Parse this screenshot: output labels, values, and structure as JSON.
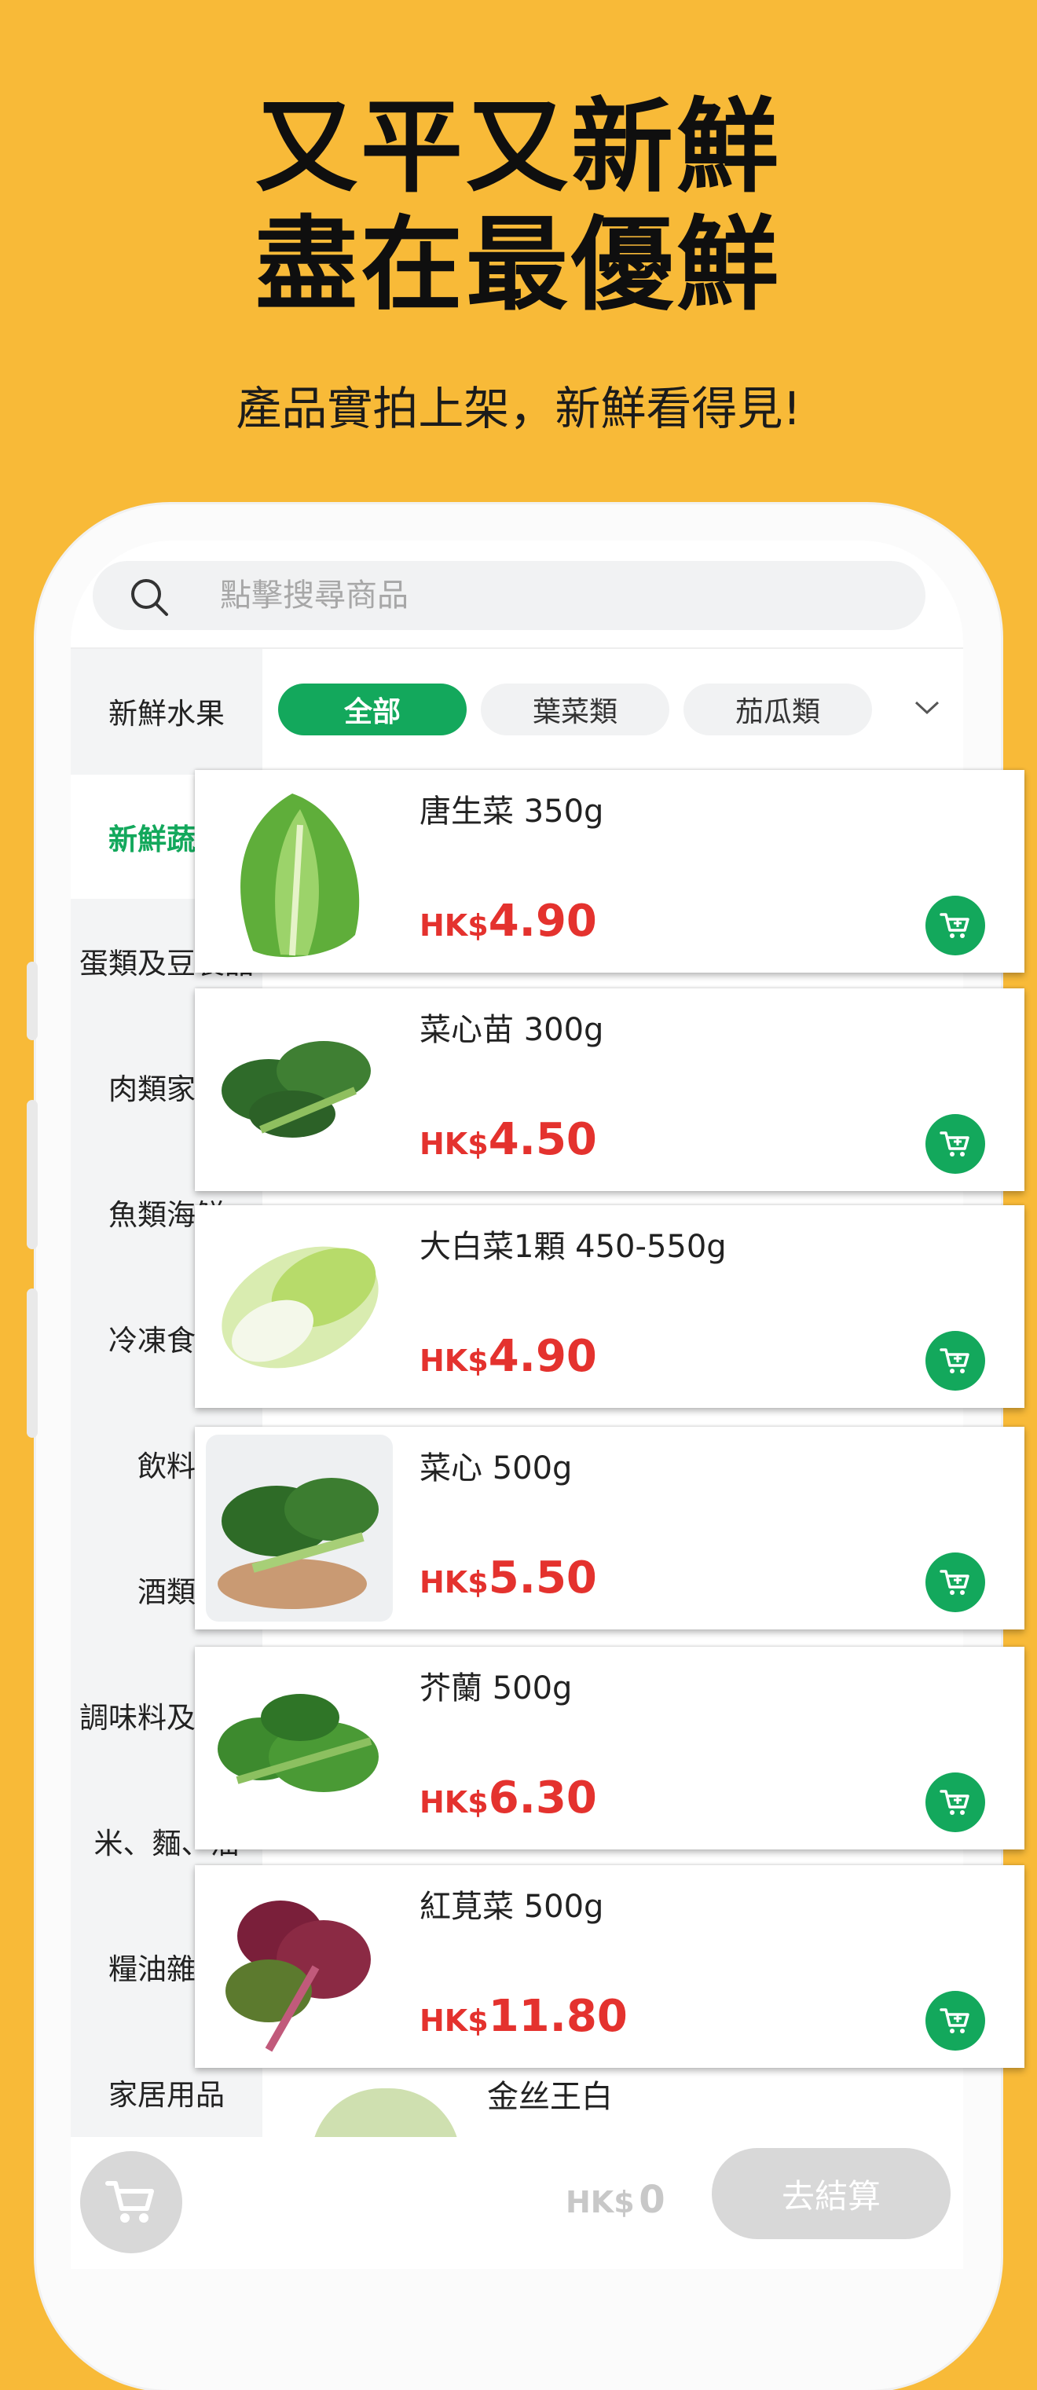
{
  "hero": {
    "headline_line1": "又平又新鮮",
    "headline_line2": "盡在最優鮮",
    "subtitle": "產品實拍上架，新鮮看得見!"
  },
  "search": {
    "placeholder": "點擊搜尋商品",
    "icon": "search-icon"
  },
  "sidebar": {
    "items": [
      {
        "label": "新鮮水果",
        "active": false
      },
      {
        "label": "新鮮蔬菜",
        "active": true
      },
      {
        "label": "蛋類及豆製品",
        "active": false
      },
      {
        "label": "肉類家禽",
        "active": false
      },
      {
        "label": "魚類海鮮",
        "active": false
      },
      {
        "label": "冷凍食品",
        "active": false
      },
      {
        "label": "飲料",
        "active": false
      },
      {
        "label": "酒類",
        "active": false
      },
      {
        "label": "調味料及醬料",
        "active": false
      },
      {
        "label": "米、麵、油",
        "active": false
      },
      {
        "label": "糧油雜貨",
        "active": false
      },
      {
        "label": "家居用品",
        "active": false
      }
    ]
  },
  "filters": {
    "chips": [
      {
        "label": "全部",
        "active": true
      },
      {
        "label": "葉菜類",
        "active": false
      },
      {
        "label": "茄瓜類",
        "active": false
      }
    ],
    "more_icon": "chevron-down-icon"
  },
  "products": [
    {
      "name": "唐生菜 350g",
      "currency": "HK$",
      "price": "4.90",
      "image": "romaine-lettuce"
    },
    {
      "name": "菜心苗 300g",
      "currency": "HK$",
      "price": "4.50",
      "image": "choy-sum-seedling"
    },
    {
      "name": "大白菜1顆 450-550g",
      "currency": "HK$",
      "price": "4.90",
      "image": "napa-cabbage"
    },
    {
      "name": "菜心 500g",
      "currency": "HK$",
      "price": "5.50",
      "image": "choy-sum"
    },
    {
      "name": "芥蘭 500g",
      "currency": "HK$",
      "price": "6.30",
      "image": "gai-lan"
    },
    {
      "name": "紅莧菜 500g",
      "currency": "HK$",
      "price": "11.80",
      "image": "red-amaranth"
    }
  ],
  "peek_product": {
    "name": "金丝王白"
  },
  "bottom_bar": {
    "currency": "HK$",
    "total": "0",
    "checkout_label": "去結算"
  },
  "colors": {
    "background": "#F8BA38",
    "accent_green": "#13A85C",
    "price_red": "#E4322E"
  }
}
